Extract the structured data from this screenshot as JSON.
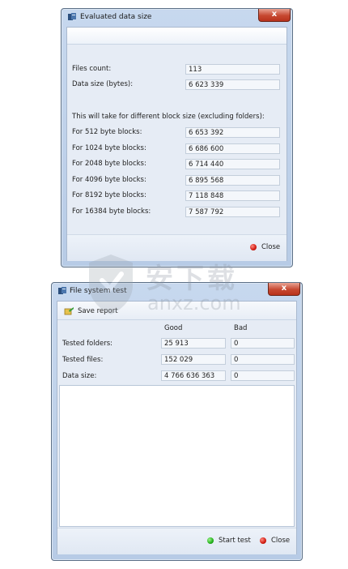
{
  "dialog1": {
    "title": "Evaluated data size",
    "close_glyph": "x",
    "files_count_label": "Files count:",
    "files_count_value": "113",
    "data_size_label": "Data size (bytes):",
    "data_size_value": "6 623 339",
    "block_note": "This will take for different block size (excluding folders):",
    "blocks": [
      {
        "label": "For 512 byte blocks:",
        "value": "6 653 392"
      },
      {
        "label": "For 1024 byte blocks:",
        "value": "6 686 600"
      },
      {
        "label": "For 2048 byte blocks:",
        "value": "6 714 440"
      },
      {
        "label": "For 4096 byte blocks:",
        "value": "6 895 568"
      },
      {
        "label": "For 8192 byte blocks:",
        "value": "7 118 848"
      },
      {
        "label": "For 16384 byte blocks:",
        "value": "7 587 792"
      }
    ],
    "close_label": "Close"
  },
  "dialog2": {
    "title": "File system test",
    "close_glyph": "x",
    "save_report_label": "Save report",
    "col_good": "Good",
    "col_bad": "Bad",
    "rows": [
      {
        "label": "Tested folders:",
        "good": "25 913",
        "bad": "0"
      },
      {
        "label": "Tested files:",
        "good": "152 029",
        "bad": "0"
      },
      {
        "label": "Data size:",
        "good": "4 766 636 363",
        "bad": "0"
      }
    ],
    "start_test_label": "Start test",
    "close_label": "Close"
  },
  "watermark": {
    "text_cn": "安下载",
    "text_en": "anxz.com"
  },
  "colors": {
    "title_close": "#c74831",
    "status_red": "#d01a10",
    "status_green": "#21b01a"
  }
}
